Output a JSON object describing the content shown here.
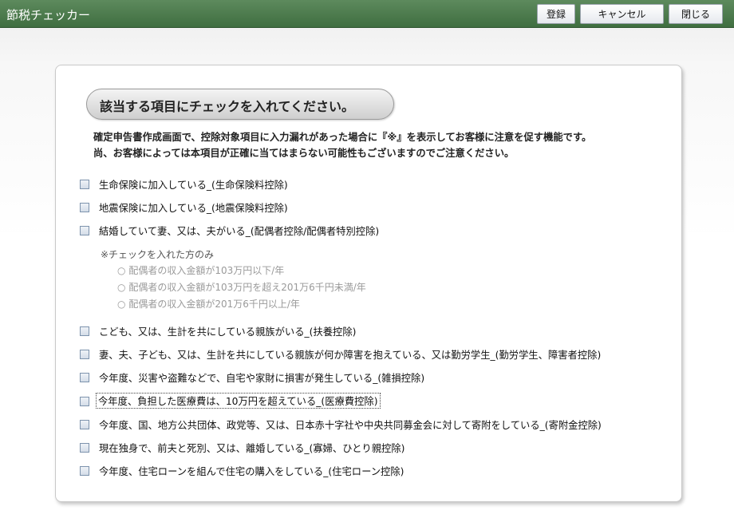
{
  "app_title": "節税チェッカー",
  "toolbar": {
    "register_label": "登録",
    "cancel_label": "キャンセル",
    "close_label": "閉じる"
  },
  "heading": "該当する項目にチェックを入れてください。",
  "description": [
    "確定申告書作成画面で、控除対象項目に入力漏れがあった場合に『※』を表示してお客様に注意を促す機能です。",
    "尚、お客様によっては本項目が正確に当てはまらない可能性もございますのでご注意ください。"
  ],
  "items": [
    {
      "label": "生命保険に加入している_(生命保険料控除)",
      "checked": false
    },
    {
      "label": "地震保険に加入している_(地震保険料控除)",
      "checked": false
    },
    {
      "label": "結婚していて妻、又は、夫がいる_(配偶者控除/配偶者特別控除)",
      "checked": false
    },
    {
      "label": "こども、又は、生計を共にしている親族がいる_(扶養控除)",
      "checked": false
    },
    {
      "label": "妻、夫、子ども、又は、生計を共にしている親族が何か障害を抱えている、又は勤労学生_(勤労学生、障害者控除)",
      "checked": false
    },
    {
      "label": "今年度、災害や盗難などで、自宅や家財に損害が発生している_(雑損控除)",
      "checked": false
    },
    {
      "label": "今年度、負担した医療費は、10万円を超えている_(医療費控除)",
      "checked": false
    },
    {
      "label": "今年度、国、地方公共団体、政党等、又は、日本赤十字社や中央共同募金会に対して寄附をしている_(寄附金控除)",
      "checked": false
    },
    {
      "label": "現在独身で、前夫と死別、又は、離婚している_(寡婦、ひとり親控除)",
      "checked": false
    },
    {
      "label": "今年度、住宅ローンを組んで住宅の購入をしている_(住宅ローン控除)",
      "checked": false
    }
  ],
  "spouse_note": "※チェックを入れた方のみ",
  "spouse_options": [
    "配偶者の収入金額が103万円以下/年",
    "配偶者の収入金額が103万円を超え201万6千円未満/年",
    "配偶者の収入金額が201万6千円以上/年"
  ],
  "radio_symbol": "○",
  "colors": {
    "title_bar": "#4a784b",
    "disabled_text": "#9a9a9a",
    "checkbox_border": "#7d93ad"
  }
}
